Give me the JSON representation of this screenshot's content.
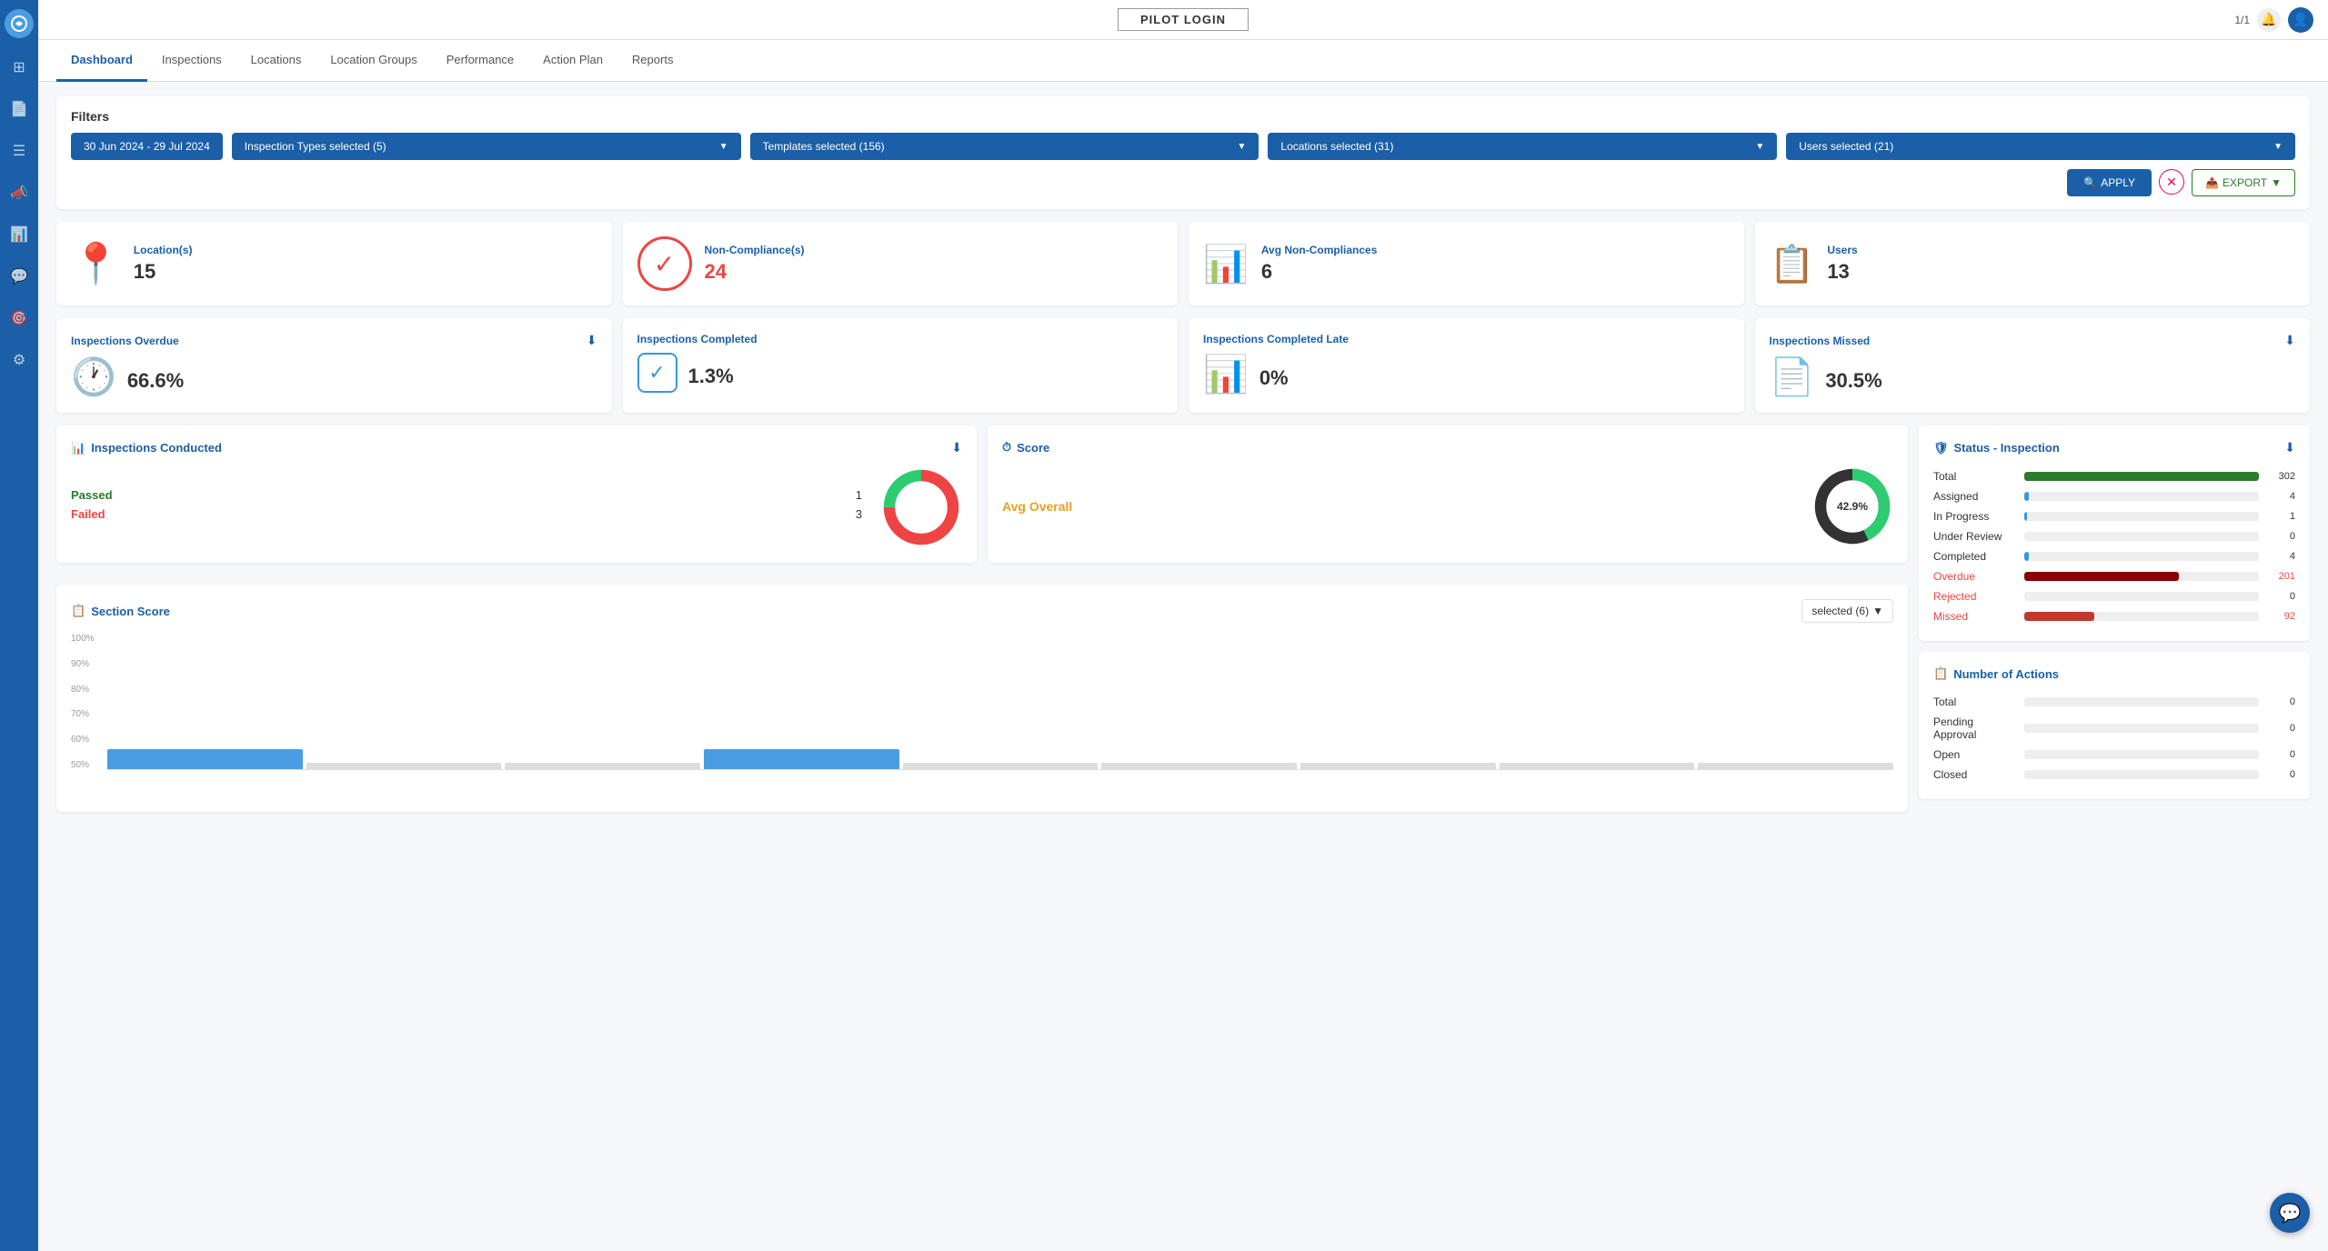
{
  "app": {
    "title": "PILOT LOGIN",
    "version": "1/1"
  },
  "nav": {
    "tabs": [
      {
        "id": "dashboard",
        "label": "Dashboard",
        "active": true
      },
      {
        "id": "inspections",
        "label": "Inspections",
        "active": false
      },
      {
        "id": "locations",
        "label": "Locations",
        "active": false
      },
      {
        "id": "location-groups",
        "label": "Location Groups",
        "active": false
      },
      {
        "id": "performance",
        "label": "Performance",
        "active": false
      },
      {
        "id": "action-plan",
        "label": "Action Plan",
        "active": false
      },
      {
        "id": "reports",
        "label": "Reports",
        "active": false
      }
    ]
  },
  "filters": {
    "title": "Filters",
    "date_range": "30 Jun 2024 - 29 Jul 2024",
    "inspection_types": "Inspection Types selected (5)",
    "templates": "Templates selected (156)",
    "locations": "Locations selected (31)",
    "users": "Users selected (21)",
    "apply_label": "APPLY",
    "export_label": "EXPORT"
  },
  "stats_row1": [
    {
      "id": "locations",
      "label": "Location(s)",
      "value": "15",
      "icon": "📍",
      "red": false
    },
    {
      "id": "non-compliance",
      "label": "Non-Compliance(s)",
      "value": "24",
      "icon": "⭕",
      "red": true
    },
    {
      "id": "avg-non-compliance",
      "label": "Avg Non-Compliances",
      "value": "6",
      "icon": "📊",
      "red": false
    },
    {
      "id": "users",
      "label": "Users",
      "value": "13",
      "icon": "📋",
      "red": false
    }
  ],
  "stats_row2": [
    {
      "id": "overdue",
      "label": "Inspections Overdue",
      "value": "66.6%",
      "icon": "🕐"
    },
    {
      "id": "completed",
      "label": "Inspections Completed",
      "value": "1.3%",
      "icon": "✅"
    },
    {
      "id": "completed-late",
      "label": "Inspections Completed Late",
      "value": "0%",
      "icon": "📊"
    },
    {
      "id": "missed",
      "label": "Inspections Missed",
      "value": "30.5%",
      "icon": "📄"
    }
  ],
  "inspections_conducted": {
    "title": "Inspections Conducted",
    "passed_label": "Passed",
    "passed_value": "1",
    "failed_label": "Failed",
    "failed_value": "3",
    "donut": {
      "passed_pct": 25,
      "failed_pct": 75
    }
  },
  "score": {
    "title": "Score",
    "avg_label": "Avg Overall",
    "avg_value": "42.9%"
  },
  "section_score": {
    "title": "Section Score",
    "filter_label": "selected (6)",
    "y_labels": [
      "100%",
      "90%",
      "80%",
      "70%",
      "60%",
      "50%"
    ],
    "bars": [
      {
        "height": 20,
        "blue": true
      },
      {
        "height": 0,
        "blue": false
      },
      {
        "height": 0,
        "blue": false
      },
      {
        "height": 20,
        "blue": true
      },
      {
        "height": 0,
        "blue": false
      },
      {
        "height": 0,
        "blue": false
      },
      {
        "height": 0,
        "blue": false
      },
      {
        "height": 0,
        "blue": false
      },
      {
        "height": 0,
        "blue": false
      }
    ]
  },
  "status_inspection": {
    "title": "Status - Inspection",
    "rows": [
      {
        "label": "Total",
        "value": 302,
        "bar_pct": 100,
        "color": "green",
        "label_class": ""
      },
      {
        "label": "Assigned",
        "value": 4,
        "bar_pct": 2,
        "color": "blue",
        "label_class": ""
      },
      {
        "label": "In Progress",
        "value": 1,
        "bar_pct": 1,
        "color": "blue",
        "label_class": ""
      },
      {
        "label": "Under Review",
        "value": 0,
        "bar_pct": 0,
        "color": "blue",
        "label_class": ""
      },
      {
        "label": "Completed",
        "value": 4,
        "bar_pct": 2,
        "color": "blue",
        "label_class": ""
      },
      {
        "label": "Overdue",
        "value": 201,
        "bar_pct": 66,
        "color": "darkred",
        "label_class": "overdue"
      },
      {
        "label": "Rejected",
        "value": 0,
        "bar_pct": 0,
        "color": "red",
        "label_class": "rejected"
      },
      {
        "label": "Missed",
        "value": 92,
        "bar_pct": 30,
        "color": "red",
        "label_class": "missed"
      }
    ]
  },
  "number_of_actions": {
    "title": "Number of Actions",
    "rows": [
      {
        "label": "Total",
        "value": 0,
        "bar_pct": 0,
        "color": "green"
      },
      {
        "label": "Pending Approval",
        "value": 0,
        "bar_pct": 0,
        "color": "blue"
      },
      {
        "label": "Open",
        "value": 0,
        "bar_pct": 0,
        "color": "blue"
      },
      {
        "label": "Closed",
        "value": 0,
        "bar_pct": 0,
        "color": "blue"
      }
    ]
  },
  "chat": {
    "icon": "💬"
  }
}
